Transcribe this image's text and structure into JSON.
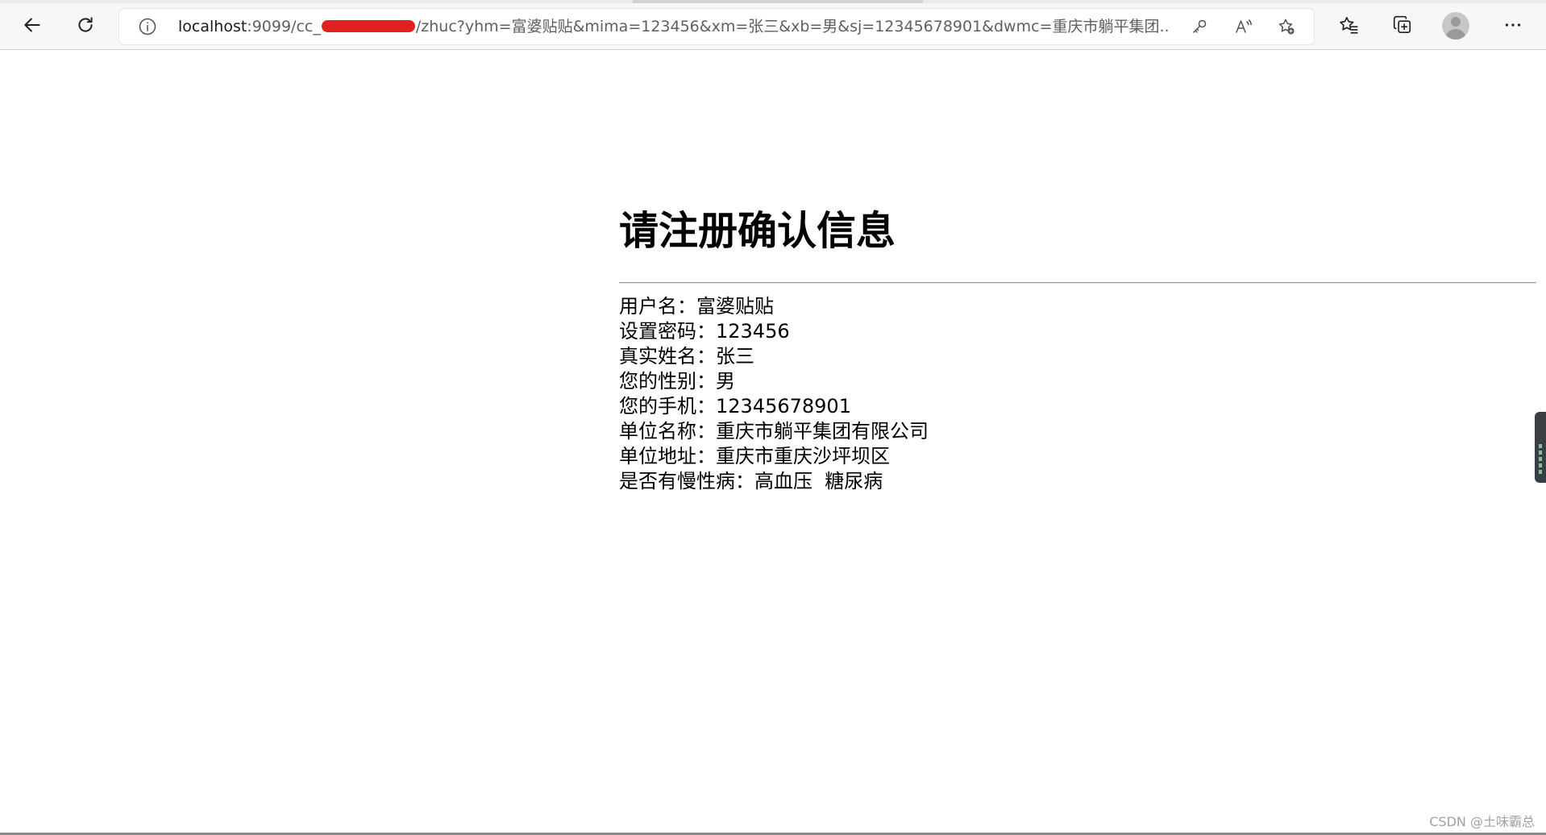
{
  "browser": {
    "url": {
      "host": "localhost",
      "port_path_prefix": ":9099/cc_",
      "path_rest": "/zhuc?yhm=富婆贴贴&mima=123456&xm=张三&xb=男&sj=12345678901&dwmc=重庆市躺平集团..."
    },
    "icons": {
      "back": "back-arrow-icon",
      "refresh": "refresh-icon",
      "site_info": "info-icon",
      "password": "key-icon",
      "read_aloud": "read-aloud-icon",
      "add_favorite": "star-add-icon",
      "favorites": "favorites-icon",
      "collections": "collections-icon",
      "profile": "profile-avatar",
      "menu": "more-icon"
    },
    "colors": {
      "toolbar_bg": "#f7f7f7",
      "redaction": "#e32020"
    }
  },
  "page": {
    "title": "请注册确认信息",
    "fields": [
      {
        "label": "用户名：",
        "value": "富婆贴贴"
      },
      {
        "label": "设置密码：",
        "value": "123456"
      },
      {
        "label": "真实姓名：",
        "value": "张三"
      },
      {
        "label": "您的性别：",
        "value": "男"
      },
      {
        "label": "您的手机：",
        "value": "12345678901"
      },
      {
        "label": "单位名称：",
        "value": "重庆市躺平集团有限公司"
      },
      {
        "label": "单位地址：",
        "value": "重庆市重庆沙坪坝区"
      },
      {
        "label": "是否有慢性病：",
        "value": "高血压  糖尿病"
      }
    ]
  },
  "watermark": "CSDN @土味霸总"
}
